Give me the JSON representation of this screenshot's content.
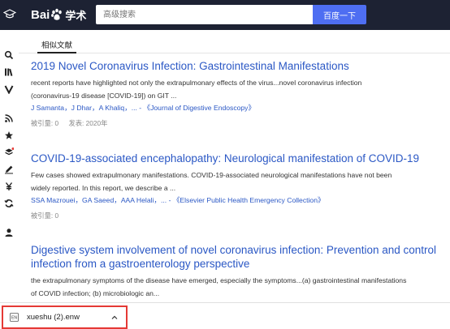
{
  "header": {
    "logo_text_1": "Bai",
    "logo_text_2": "学术",
    "search_placeholder": "高级搜索",
    "search_button": "百度一下"
  },
  "tabs": [
    {
      "label": "相似文献",
      "active": true
    }
  ],
  "sidebar": {
    "icons": [
      "search-icon",
      "library-icon",
      "v-icon",
      "rss-icon",
      "star-icon",
      "cube-icon",
      "pen-icon",
      "yen-icon",
      "refresh-icon",
      "user-icon"
    ]
  },
  "results": [
    {
      "title": "2019 Novel Coronavirus Infection: Gastrointestinal Manifestations",
      "abstract_line1": "recent reports have highlighted not only the extrapulmonary effects of the virus...novel coronavirus infection",
      "abstract_line2": "(coronavirus-19 disease [COVID-19]) on GIT ...",
      "authors": "J Samanta，J Dhar，A Khaliq，... - 《Journal of Digestive Endoscopy》",
      "cited": "被引量: 0",
      "published": "发表: 2020年"
    },
    {
      "title": "COVID-19-associated encephalopathy: Neurological manifestation of COVID-19",
      "abstract_line1": "Few cases showed extrapulmonary manifestations. COVID-19-associated neurological manifestations have not been",
      "abstract_line2": "widely reported. In this report, we describe a ...",
      "authors": "SSA Mazrouei，GA Saeed，AAA Helali，... - 《Elsevier Public Health Emergency Collection》",
      "cited": "被引量: 0"
    },
    {
      "title_line1": "Digestive system involvement of novel coronavirus infection: Prevention and control",
      "title_line2": "infection from a gastroenterology perspective",
      "abstract_line1": "the extrapulmonary symptoms of the disease have emerged, especially the symptoms...(a) gastrointestinal manifestations",
      "abstract_line2": "of COVID infection; (b) microbiologic an..."
    }
  ],
  "download": {
    "file_name": "xueshu (2).enw",
    "file_badge": "EN"
  },
  "colors": {
    "header_bg": "#1d2233",
    "search_button_bg": "#4e6ef2",
    "link_blue": "#2b58c5",
    "highlight_red": "#e53935"
  }
}
